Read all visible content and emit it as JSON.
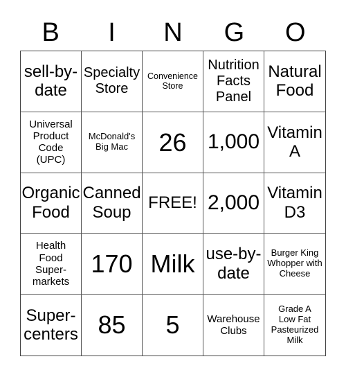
{
  "header": {
    "letters": [
      "B",
      "I",
      "N",
      "G",
      "O"
    ]
  },
  "card": {
    "rows": [
      [
        {
          "text": "sell-by-date"
        },
        {
          "text": "Specialty Store"
        },
        {
          "text": "Convenience Store"
        },
        {
          "text": "Nutrition Facts Panel"
        },
        {
          "text": "Natural Food"
        }
      ],
      [
        {
          "text": "Universal Product Code (UPC)"
        },
        {
          "text": "McDonald's Big Mac"
        },
        {
          "text": "26"
        },
        {
          "text": "1,000"
        },
        {
          "text": "Vitamin A"
        }
      ],
      [
        {
          "text": "Organic Food"
        },
        {
          "text": "Canned Soup"
        },
        {
          "text": "FREE!"
        },
        {
          "text": "2,000"
        },
        {
          "text": "Vitamin D3"
        }
      ],
      [
        {
          "text": "Health Food Super-markets"
        },
        {
          "text": "170"
        },
        {
          "text": "Milk"
        },
        {
          "text": "use-by-date"
        },
        {
          "text": "Burger King Whopper with Cheese"
        }
      ],
      [
        {
          "text": "Super-centers"
        },
        {
          "text": "85"
        },
        {
          "text": "5"
        },
        {
          "text": "Warehouse Clubs"
        },
        {
          "text": "Grade A Low Fat Pasteurized Milk"
        }
      ]
    ]
  }
}
